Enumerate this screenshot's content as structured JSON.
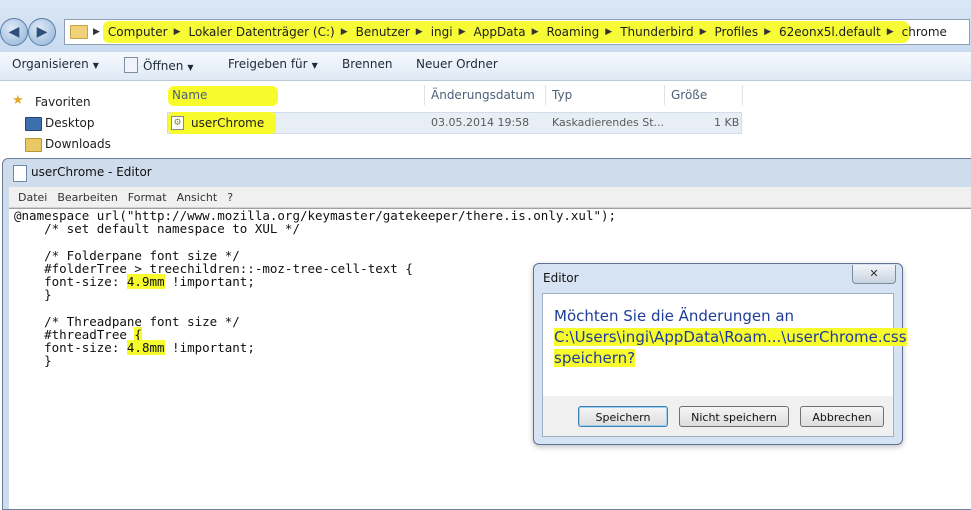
{
  "explorer": {
    "nav": {
      "back": "◀",
      "forward": "▶"
    },
    "breadcrumb": [
      "Computer",
      "Lokaler Datenträger (C:)",
      "Benutzer",
      "ingi",
      "AppData",
      "Roaming",
      "Thunderbird",
      "Profiles",
      "62eonx5l.default",
      "chrome"
    ],
    "toolbar": {
      "organize": "Organisieren",
      "open": "Öffnen",
      "share": "Freigeben für",
      "burn": "Brennen",
      "new_folder": "Neuer Ordner"
    },
    "sidebar": {
      "favorites": "Favoriten",
      "items": [
        "Desktop",
        "Downloads"
      ]
    },
    "columns": {
      "name": "Name",
      "date": "Änderungsdatum",
      "type": "Typ",
      "size": "Größe"
    },
    "files": [
      {
        "name": "userChrome",
        "date": "03.05.2014 19:58",
        "type": "Kaskadierendes St...",
        "size": "1 KB"
      }
    ]
  },
  "notepad": {
    "title": "userChrome - Editor",
    "menu": [
      "Datei",
      "Bearbeiten",
      "Format",
      "Ansicht",
      "?"
    ],
    "lines": {
      "l1": "@namespace url(\"http://www.mozilla.org/keymaster/gatekeeper/there.is.only.xul\");",
      "l2": "    /* set default namespace to XUL */",
      "l4": "    /* Folderpane font size */",
      "l5": "    #folderTree > treechildren::-moz-tree-cell-text {",
      "l6_pre": "    font-size: ",
      "l6_val": "4.9mm",
      "l6_post": " !important;",
      "l7": "    }",
      "l9": "    /* Threadpane font size */",
      "l10_pre": "    #threadTree ",
      "l10_brace": "{",
      "l11_pre": "    font-size: ",
      "l11_val": "4.8mm",
      "l11_post": " !important;",
      "l12": "    }"
    }
  },
  "dialog": {
    "title": "Editor",
    "close": "✕",
    "message_line1": "Möchten Sie die Änderungen an",
    "message_line2": "C:\\Users\\ingi\\AppData\\Roam...\\userChrome.css",
    "message_line3": "speichern?",
    "buttons": {
      "save": "Speichern",
      "dont_save": "Nicht speichern",
      "cancel": "Abbrechen"
    }
  },
  "colors": {
    "highlight": "#f7fb2b",
    "message": "#1f3c9a"
  }
}
